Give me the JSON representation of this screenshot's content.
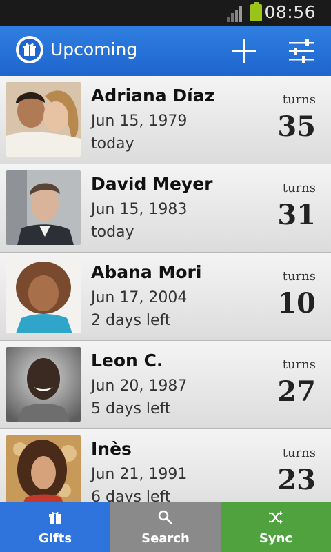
{
  "status_bar": {
    "time": "08:56"
  },
  "app_bar": {
    "title": "Upcoming"
  },
  "contacts": [
    {
      "name": "Adriana Díaz",
      "date": "Jun 15, 1979",
      "remaining": "today",
      "turns_label": "turns",
      "age": "35"
    },
    {
      "name": "David Meyer",
      "date": "Jun 15, 1983",
      "remaining": "today",
      "turns_label": "turns",
      "age": "31"
    },
    {
      "name": "Abana Mori",
      "date": "Jun 17, 2004",
      "remaining": "2 days left",
      "turns_label": "turns",
      "age": "10"
    },
    {
      "name": "Leon C.",
      "date": "Jun 20, 1987",
      "remaining": "5 days left",
      "turns_label": "turns",
      "age": "27"
    },
    {
      "name": "Inès",
      "date": "Jun 21, 1991",
      "remaining": "6 days left",
      "turns_label": "turns",
      "age": "23"
    }
  ],
  "bottom_tabs": [
    {
      "label": "Gifts",
      "icon": "gift-icon",
      "color": "#2f73dc"
    },
    {
      "label": "Search",
      "icon": "search-icon",
      "color": "#8a8a8a"
    },
    {
      "label": "Sync",
      "icon": "shuffle-icon",
      "color": "#4fa23e"
    }
  ],
  "colors": {
    "app_bar": "#1f65cf",
    "status_bar": "#1a1a1a",
    "battery": "#9ac41a"
  }
}
